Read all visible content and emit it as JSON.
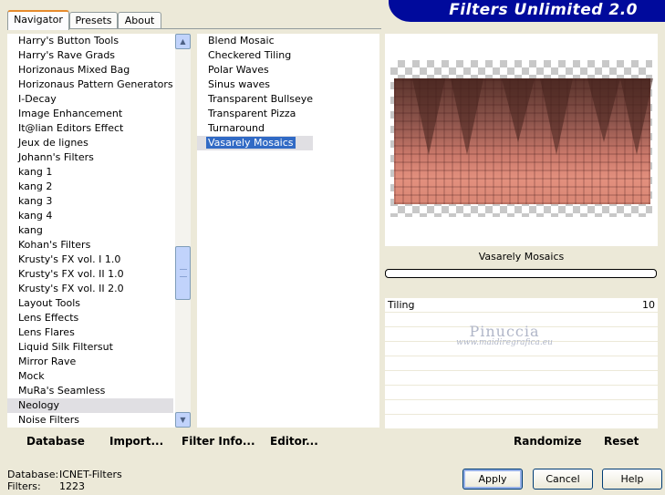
{
  "tabs": [
    {
      "label": "Navigator",
      "active": true
    },
    {
      "label": "Presets",
      "active": false
    },
    {
      "label": "About",
      "active": false
    }
  ],
  "banner": {
    "title": "Filters Unlimited 2.0",
    "color": "#000a9c"
  },
  "categories": [
    "Harry's Button Tools",
    "Harry's Rave Grads",
    "Horizonaus Mixed Bag",
    "Horizonaus Pattern Generators",
    "I-Decay",
    "Image Enhancement",
    "It@lian Editors Effect",
    "Jeux de lignes",
    "Johann's Filters",
    "kang 1",
    "kang 2",
    "kang 3",
    "kang 4",
    "kang",
    "Kohan's Filters",
    "Krusty's FX vol. I 1.0",
    "Krusty's FX vol. II 1.0",
    "Krusty's FX vol. II 2.0",
    "Layout Tools",
    "Lens Effects",
    "Lens Flares",
    "Liquid Silk Filtersut",
    "Mirror Rave",
    "Mock",
    "MuRa's Seamless",
    "Neology",
    "Noise Filters"
  ],
  "selected_category": "Neology",
  "filters": [
    "Blend Mosaic",
    "Checkered Tiling",
    "Polar Waves",
    "Sinus waves",
    "Transparent Bullseye",
    "Transparent Pizza",
    "Turnaround",
    "Vasarely Mosaics"
  ],
  "selected_filter": "Vasarely Mosaics",
  "preview": {
    "filter_name": "Vasarely Mosaics",
    "progress": 0
  },
  "params": [
    {
      "label": "Tiling",
      "value": "10"
    }
  ],
  "watermark": {
    "line1": "Pinuccia",
    "line2": "www.maidiregrafica.eu"
  },
  "left_buttons": {
    "database": "Database",
    "import": "Import...",
    "filter_info": "Filter Info...",
    "editor": "Editor..."
  },
  "right_buttons": {
    "randomize": "Randomize",
    "reset": "Reset"
  },
  "status": {
    "database_label": "Database:",
    "database_value": "ICNET-Filters",
    "filters_label": "Filters:",
    "filters_value": "1223"
  },
  "dialog_buttons": {
    "apply": "Apply",
    "cancel": "Cancel",
    "help": "Help"
  },
  "scrollbar": {
    "up_icon": "arrow-up-icon",
    "down_icon": "arrow-down-icon"
  }
}
